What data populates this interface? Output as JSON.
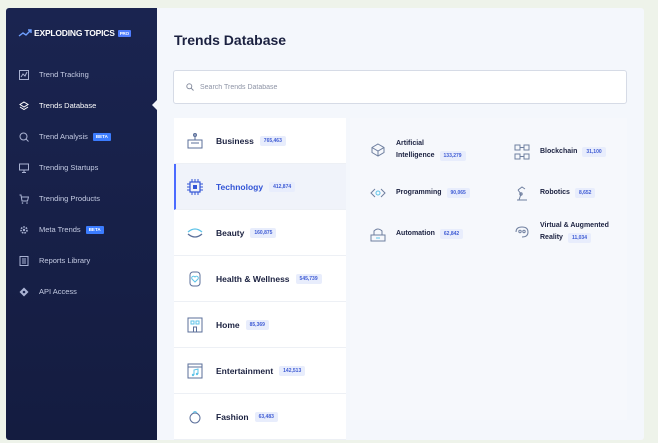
{
  "brand": {
    "name": "EXPLODING TOPICS",
    "tag": "PRO"
  },
  "sidebar": {
    "items": [
      {
        "label": "Trend Tracking",
        "icon": "chart-icon",
        "badge": ""
      },
      {
        "label": "Trends Database",
        "icon": "layers-icon",
        "badge": "",
        "active": true
      },
      {
        "label": "Trend Analysis",
        "icon": "analysis-icon",
        "badge": "BETA"
      },
      {
        "label": "Trending Startups",
        "icon": "monitor-icon",
        "badge": ""
      },
      {
        "label": "Trending Products",
        "icon": "cart-icon",
        "badge": ""
      },
      {
        "label": "Meta Trends",
        "icon": "gear-icon",
        "badge": "BETA"
      },
      {
        "label": "Reports Library",
        "icon": "book-icon",
        "badge": ""
      },
      {
        "label": "API Access",
        "icon": "api-icon",
        "badge": ""
      }
    ]
  },
  "main": {
    "title": "Trends Database",
    "search": {
      "placeholder": "Search Trends Database",
      "value": ""
    }
  },
  "categories": [
    {
      "label": "Business",
      "count": "765,463",
      "icon": "business-icon"
    },
    {
      "label": "Technology",
      "count": "412,874",
      "icon": "chip-icon",
      "active": true
    },
    {
      "label": "Beauty",
      "count": "160,875",
      "icon": "beauty-icon"
    },
    {
      "label": "Health & Wellness",
      "count": "545,739",
      "icon": "health-icon"
    },
    {
      "label": "Home",
      "count": "85,369",
      "icon": "home-icon"
    },
    {
      "label": "Entertainment",
      "count": "142,513",
      "icon": "entertainment-icon"
    },
    {
      "label": "Fashion",
      "count": "63,483",
      "icon": "fashion-icon"
    }
  ],
  "subcategories": [
    {
      "line1": "Artificial",
      "line2": "Intelligence",
      "count": "133,279",
      "icon": "ai-icon"
    },
    {
      "line1": "Blockchain",
      "line2": "",
      "count": "31,100",
      "icon": "blockchain-icon"
    },
    {
      "line1": "Programming",
      "line2": "",
      "count": "90,065",
      "icon": "code-icon"
    },
    {
      "line1": "Robotics",
      "line2": "",
      "count": "8,652",
      "icon": "robot-icon"
    },
    {
      "line1": "Automation",
      "line2": "",
      "count": "62,842",
      "icon": "automation-icon"
    },
    {
      "line1": "Virtual & Augmented",
      "line2": "Reality",
      "count": "11,034",
      "icon": "vr-icon"
    }
  ],
  "colors": {
    "sidebar": "#1a2450",
    "accent": "#3254d6",
    "badge": "#e8edfc"
  }
}
